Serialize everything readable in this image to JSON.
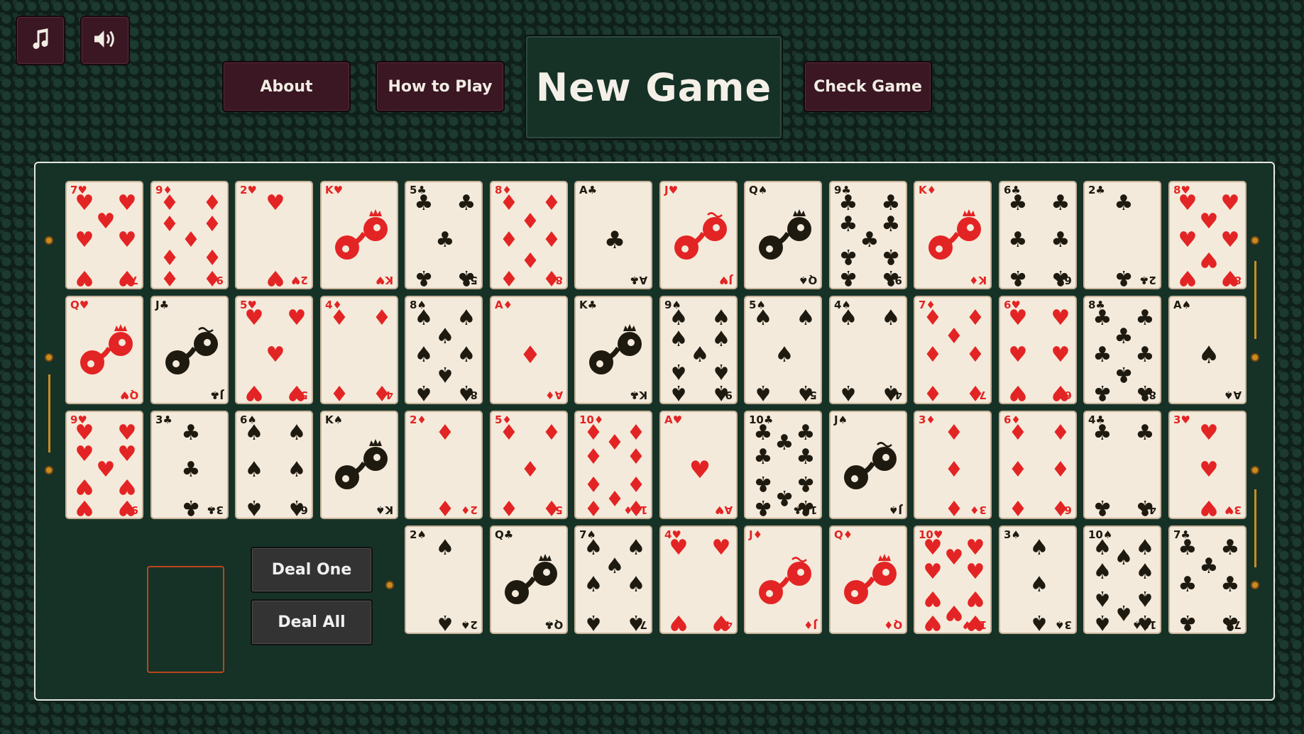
{
  "toolbar": {
    "music_icon": "music-note-icon",
    "sound_icon": "speaker-icon",
    "about_label": "About",
    "how_to_play_label": "How to Play",
    "new_game_label": "New Game",
    "check_game_label": "Check Game"
  },
  "controls": {
    "deal_one_label": "Deal One",
    "deal_all_label": "Deal All"
  },
  "colors": {
    "red_suit": "#e32424",
    "black_suit": "#1e1a10",
    "button": "#3a1723",
    "felt": "#163227",
    "accent": "#c98c20"
  },
  "tableau": [
    [
      "7♥",
      "9♦",
      "2♥",
      "K♥",
      "5♣",
      "8♦",
      "A♣",
      "J♥",
      "Q♠",
      "9♣",
      "K♦",
      "6♣",
      "2♣",
      "8♥"
    ],
    [
      "Q♥",
      "J♣",
      "5♥",
      "4♦",
      "8♠",
      "A♦",
      "K♣",
      "9♠",
      "5♠",
      "4♠",
      "7♦",
      "6♥",
      "8♣",
      "A♠"
    ],
    [
      "9♥",
      "3♣",
      "6♠",
      "K♠",
      "2♦",
      "5♦",
      "10♦",
      "A♥",
      "10♣",
      "J♠",
      "3♦",
      "6♦",
      "4♣",
      "3♥"
    ],
    [
      "2♠",
      "Q♣",
      "7♠",
      "4♥",
      "J♦",
      "Q♦",
      "10♥",
      "3♠",
      "10♠",
      "7♣"
    ]
  ]
}
